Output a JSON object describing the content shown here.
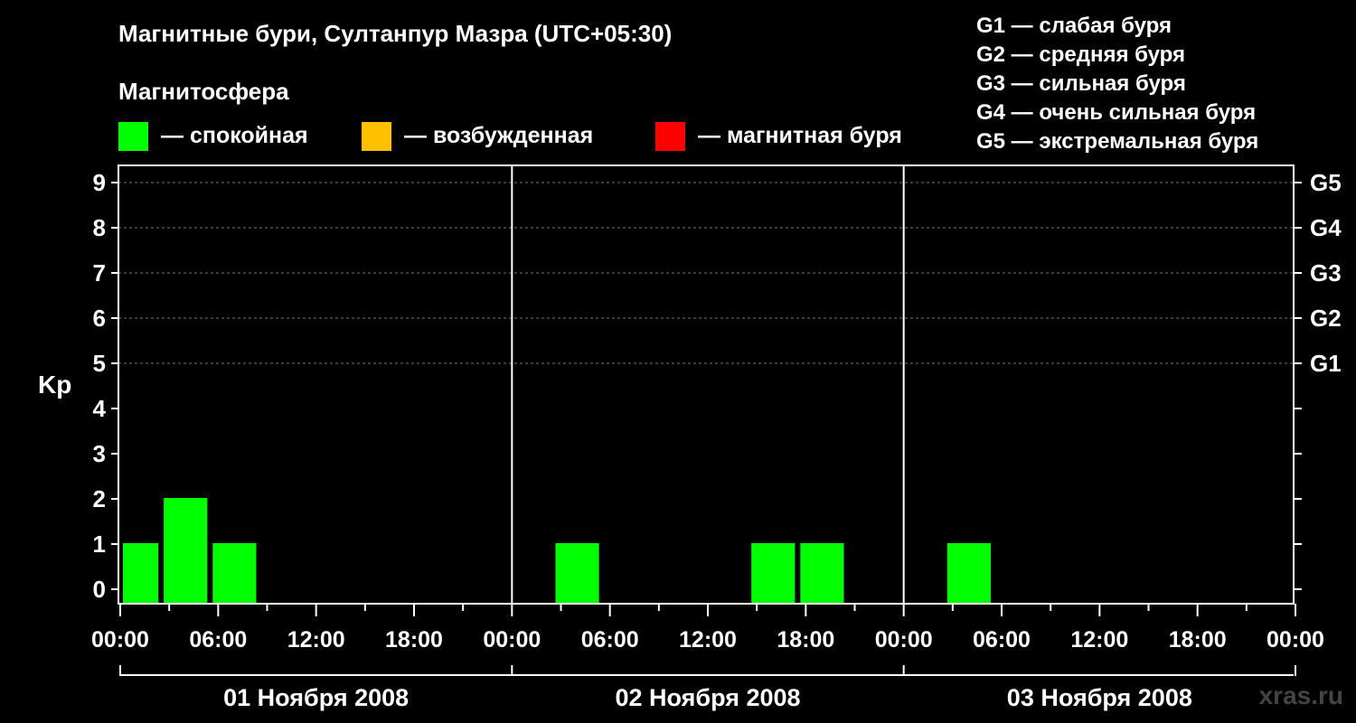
{
  "header": {
    "title": "Магнитные бури, Султанпур Мазра (UTC+05:30)",
    "magnetosphere_label": "Магнитосфера"
  },
  "legend": [
    {
      "label": "— спокойная",
      "color": "#00ff00"
    },
    {
      "label": "— возбужденная",
      "color": "#ffc000"
    },
    {
      "label": "— магнитная буря",
      "color": "#ff0000"
    }
  ],
  "storm_levels": [
    "G1 — слабая буря",
    "G2 — средняя буря",
    "G3 — сильная буря",
    "G4 — очень сильная буря",
    "G5 — экстремальная буря"
  ],
  "watermark": "xras.ru",
  "chart_data": {
    "type": "bar",
    "ylabel": "Kp",
    "ylim": [
      0,
      9
    ],
    "y_ticks": [
      "0",
      "1",
      "2",
      "3",
      "4",
      "5",
      "6",
      "7",
      "8",
      "9"
    ],
    "right_ticks": [
      {
        "kp": 5,
        "label": "G1"
      },
      {
        "kp": 6,
        "label": "G2"
      },
      {
        "kp": 7,
        "label": "G3"
      },
      {
        "kp": 8,
        "label": "G4"
      },
      {
        "kp": 9,
        "label": "G5"
      }
    ],
    "x_tick_labels": [
      "00:00",
      "06:00",
      "12:00",
      "18:00",
      "00:00",
      "06:00",
      "12:00",
      "18:00",
      "00:00",
      "06:00",
      "12:00",
      "18:00",
      "00:00"
    ],
    "days": [
      "01 Ноября 2008",
      "02 Ноября 2008",
      "03 Ноября 2008"
    ],
    "bar_color": "#00ff00",
    "bars": [
      {
        "day": 0,
        "start": "00:00",
        "end": "02:30",
        "kp": 1
      },
      {
        "day": 0,
        "start": "02:30",
        "end": "05:30",
        "kp": 2
      },
      {
        "day": 0,
        "start": "05:30",
        "end": "08:30",
        "kp": 1
      },
      {
        "day": 1,
        "start": "02:30",
        "end": "05:30",
        "kp": 1
      },
      {
        "day": 1,
        "start": "14:30",
        "end": "17:30",
        "kp": 1
      },
      {
        "day": 1,
        "start": "17:30",
        "end": "20:30",
        "kp": 1
      },
      {
        "day": 2,
        "start": "02:30",
        "end": "05:30",
        "kp": 1
      }
    ]
  }
}
